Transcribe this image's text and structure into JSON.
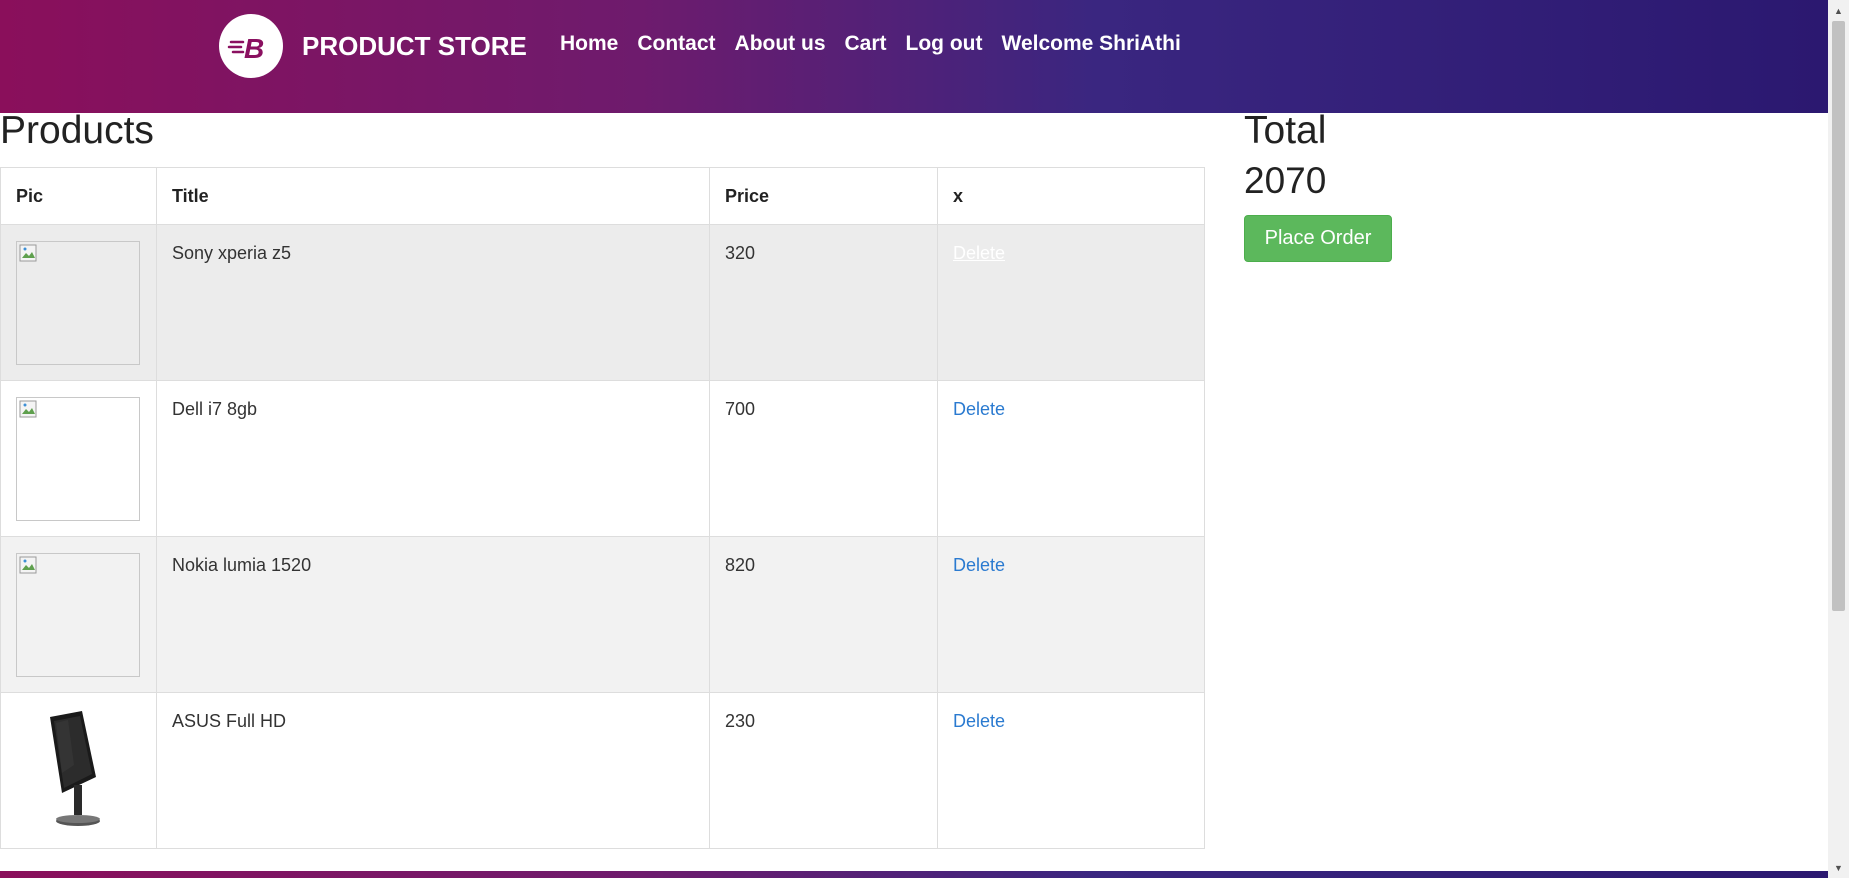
{
  "navbar": {
    "brand_title": "PRODUCT STORE",
    "logo_letter": "B",
    "links": [
      "Home",
      "Contact",
      "About us",
      "Cart",
      "Log out",
      "Welcome ShriAthi"
    ]
  },
  "products": {
    "heading": "Products",
    "columns": [
      "Pic",
      "Title",
      "Price",
      "x"
    ],
    "rows": [
      {
        "title": "Sony xperia z5",
        "price": "320",
        "action": "Delete",
        "pic": "broken-image"
      },
      {
        "title": "Dell i7 8gb",
        "price": "700",
        "action": "Delete",
        "pic": "broken-image"
      },
      {
        "title": "Nokia lumia 1520",
        "price": "820",
        "action": "Delete",
        "pic": "broken-image"
      },
      {
        "title": "ASUS Full HD",
        "price": "230",
        "action": "Delete",
        "pic": "monitor-image"
      }
    ]
  },
  "summary": {
    "total_label": "Total",
    "total_value": "2070",
    "place_order_label": "Place Order"
  },
  "colors": {
    "header_gradient_start": "#8a0f5b",
    "header_gradient_end": "#2b1870",
    "button_green": "#5cb85c",
    "link_blue": "#2a7ad0"
  }
}
